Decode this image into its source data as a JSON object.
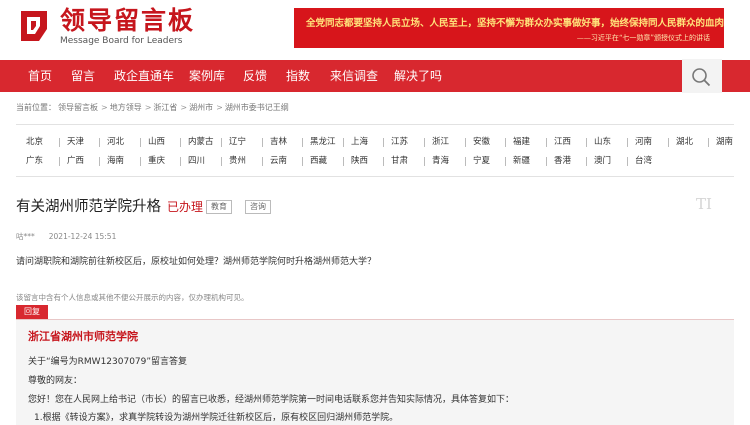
{
  "header": {
    "logo_title": "领导留言板",
    "logo_subtitle": "Message Board for Leaders",
    "banner_line1": "全党同志都要坚持人民立场、人民至上，坚持不懈为群众办实事做好事，始终保持同人民群众的血肉联系。",
    "banner_line2": "——习近平在“七一勋章”颁授仪式上的讲话"
  },
  "nav": {
    "items": [
      "首页",
      "留言",
      "政企直通车",
      "案例库",
      "反馈",
      "指数",
      "来信调查",
      "解决了吗"
    ]
  },
  "breadcrumb": {
    "prefix": "当前位置：",
    "items": [
      "领导留言板",
      "地方领导",
      "浙江省",
      "湖州市",
      "湖州市委书记王纲"
    ],
    "separator": ">"
  },
  "provinces": {
    "row1": [
      "北京",
      "天津",
      "河北",
      "山西",
      "内蒙古",
      "辽宁",
      "吉林",
      "黑龙江",
      "上海",
      "江苏",
      "浙江",
      "安徽",
      "福建",
      "江西",
      "山东",
      "河南",
      "湖北",
      "湖南"
    ],
    "row2": [
      "广东",
      "广西",
      "海南",
      "重庆",
      "四川",
      "贵州",
      "云南",
      "西藏",
      "陕西",
      "甘肃",
      "青海",
      "宁夏",
      "新疆",
      "香港",
      "澳门",
      "台湾"
    ]
  },
  "article": {
    "title": "有关湖州师范学院升格",
    "status": "已办理",
    "tags": [
      "教育",
      "咨询"
    ],
    "watermark": "TI",
    "author": "咕***",
    "date": "2021-12-24 15:51",
    "question": "请问湖职院和湖院前往新校区后，原校址如何处理？湖州师范学院何时升格湖州师范大学？",
    "notice": "该留言中含有个人信息或其他不便公开展示的内容，仅办理机构可见。"
  },
  "reply": {
    "tab_label": "回复",
    "org": "浙江省湖州市师范学院",
    "lines": [
      "关于“编号为RMW12307079”留言答复",
      "尊敬的网友：",
      "您好！您在人民网上给书记（市长）的留言已收悉，经湖州师范学院第一时间电话联系您并告知实际情况，具体答复如下：",
      "1.根据《转设方案》，求真学院转设为湖州学院迁往新校区后，原有校区回归湖州师范学院。"
    ]
  },
  "colors": {
    "brand_red": "#d8282f",
    "logo_red": "#c6161d"
  },
  "icons": {
    "search": "search-icon",
    "logo": "logo-mark-icon"
  }
}
